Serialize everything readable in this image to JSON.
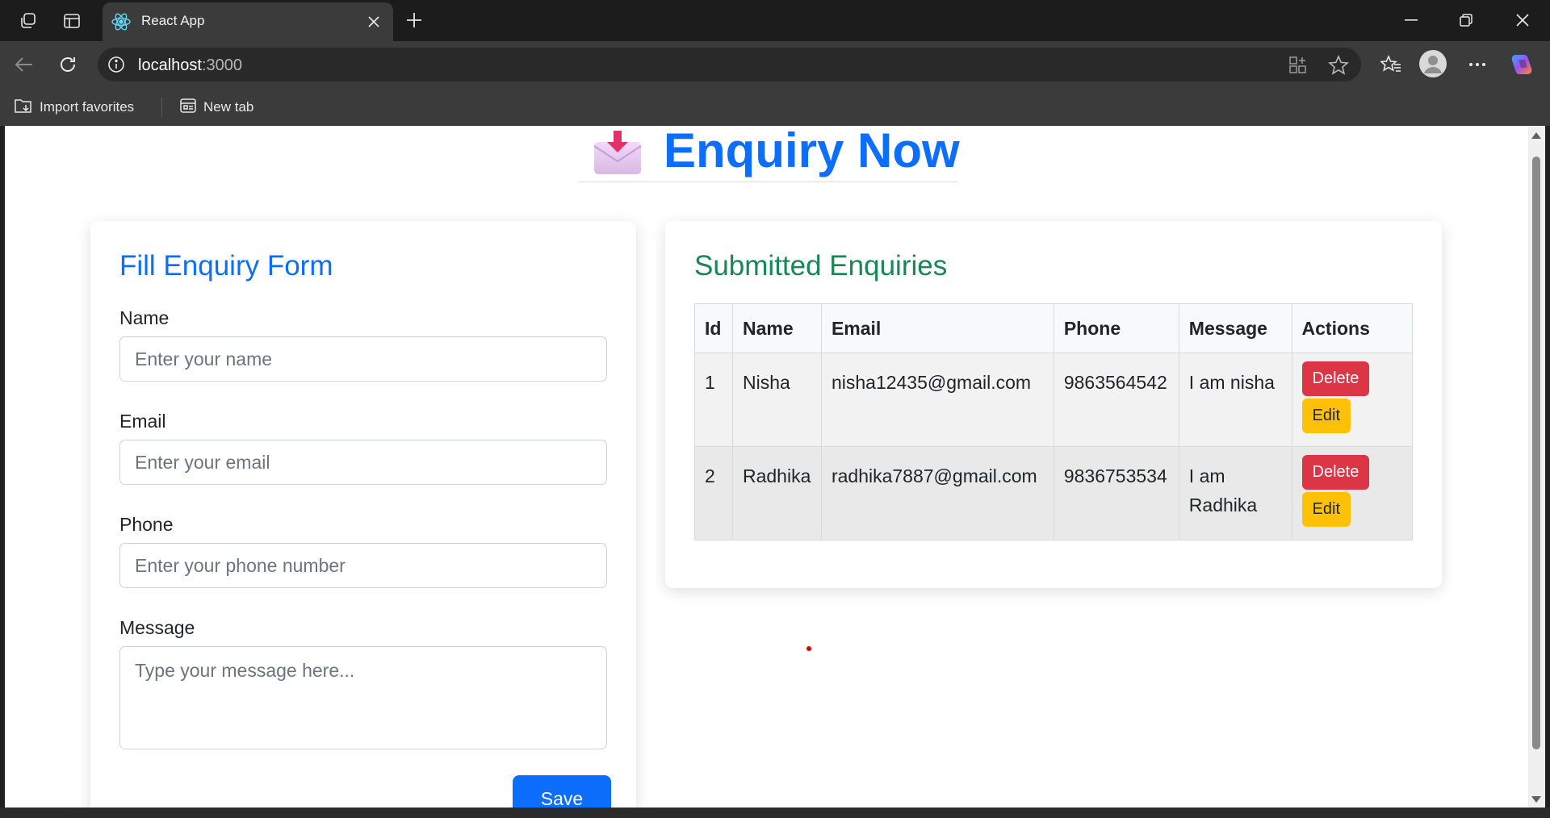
{
  "browser": {
    "tab_title": "React App",
    "url_host": "localhost",
    "url_port": ":3000",
    "favorites": [
      {
        "label": "Import favorites",
        "icon": "import-favorites-icon"
      },
      {
        "label": "New tab",
        "icon": "new-tab-page-icon"
      }
    ]
  },
  "page": {
    "title": "Enquiry Now",
    "title_icon": "envelope-with-arrow-icon",
    "title_color": "#0d6efd"
  },
  "form": {
    "title": "Fill Enquiry Form",
    "name_label": "Name",
    "name_placeholder": "Enter your name",
    "email_label": "Email",
    "email_placeholder": "Enter your email",
    "phone_label": "Phone",
    "phone_placeholder": "Enter your phone number",
    "message_label": "Message",
    "message_placeholder": "Type your message here...",
    "save_label": "Save",
    "accent": "#0d6efd"
  },
  "enquiries": {
    "title": "Submitted Enquiries",
    "accent": "#198754",
    "columns": [
      "Id",
      "Name",
      "Email",
      "Phone",
      "Message",
      "Actions"
    ],
    "rows": [
      {
        "id": "1",
        "name": "Nisha",
        "email": "nisha12435@gmail.com",
        "phone": "9863564542",
        "message": "I am nisha",
        "delete_label": "Delete",
        "edit_label": "Edit"
      },
      {
        "id": "2",
        "name": "Radhika",
        "email": "radhika7887@gmail.com",
        "phone": "9836753534",
        "message": "I am Radhika",
        "delete_label": "Delete",
        "edit_label": "Edit"
      }
    ],
    "delete_color": "#dc3545",
    "edit_color": "#ffc107"
  }
}
